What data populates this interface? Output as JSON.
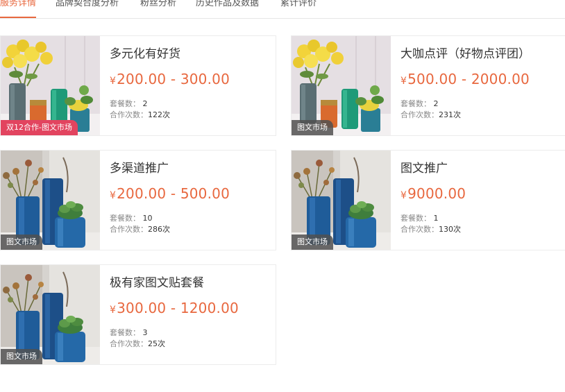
{
  "tabs": [
    {
      "label": "服务详情",
      "active": true
    },
    {
      "label": "品牌契合度分析",
      "active": false
    },
    {
      "label": "粉丝分析",
      "active": false
    },
    {
      "label": "历史作品及数据",
      "active": false
    },
    {
      "label": "累计评价",
      "active": false
    }
  ],
  "labels": {
    "package_count": "套餐数：",
    "coop_count": "合作次数：",
    "currency": "¥"
  },
  "cards": [
    {
      "title": "多元化有好货",
      "price": "200.00 - 300.00",
      "packages": "2",
      "cooperations": "122次",
      "tag": "双12合作-图文市场",
      "image": "flower-vase-image"
    },
    {
      "title": "大咖点评（好物点评团）",
      "price": "500.00 - 2000.00",
      "packages": "2",
      "cooperations": "231次",
      "tag": "图文市场",
      "image": "flower-vase-image"
    },
    {
      "title": "多渠道推广",
      "price": "200.00 - 500.00",
      "packages": "10",
      "cooperations": "286次",
      "tag": "图文市场",
      "image": "blue-vase-image"
    },
    {
      "title": "图文推广",
      "price": "9000.00",
      "packages": "1",
      "cooperations": "130次",
      "tag": "图文市场",
      "image": "blue-vase-image"
    },
    {
      "title": "极有家图文贴套餐",
      "price": "300.00 - 1200.00",
      "packages": "3",
      "cooperations": "25次",
      "tag": "图文市场",
      "image": "blue-vase-image"
    }
  ],
  "colors": {
    "accent": "#e8683f",
    "tag_pink": "#e2445f",
    "tag_gray": "#505050"
  }
}
